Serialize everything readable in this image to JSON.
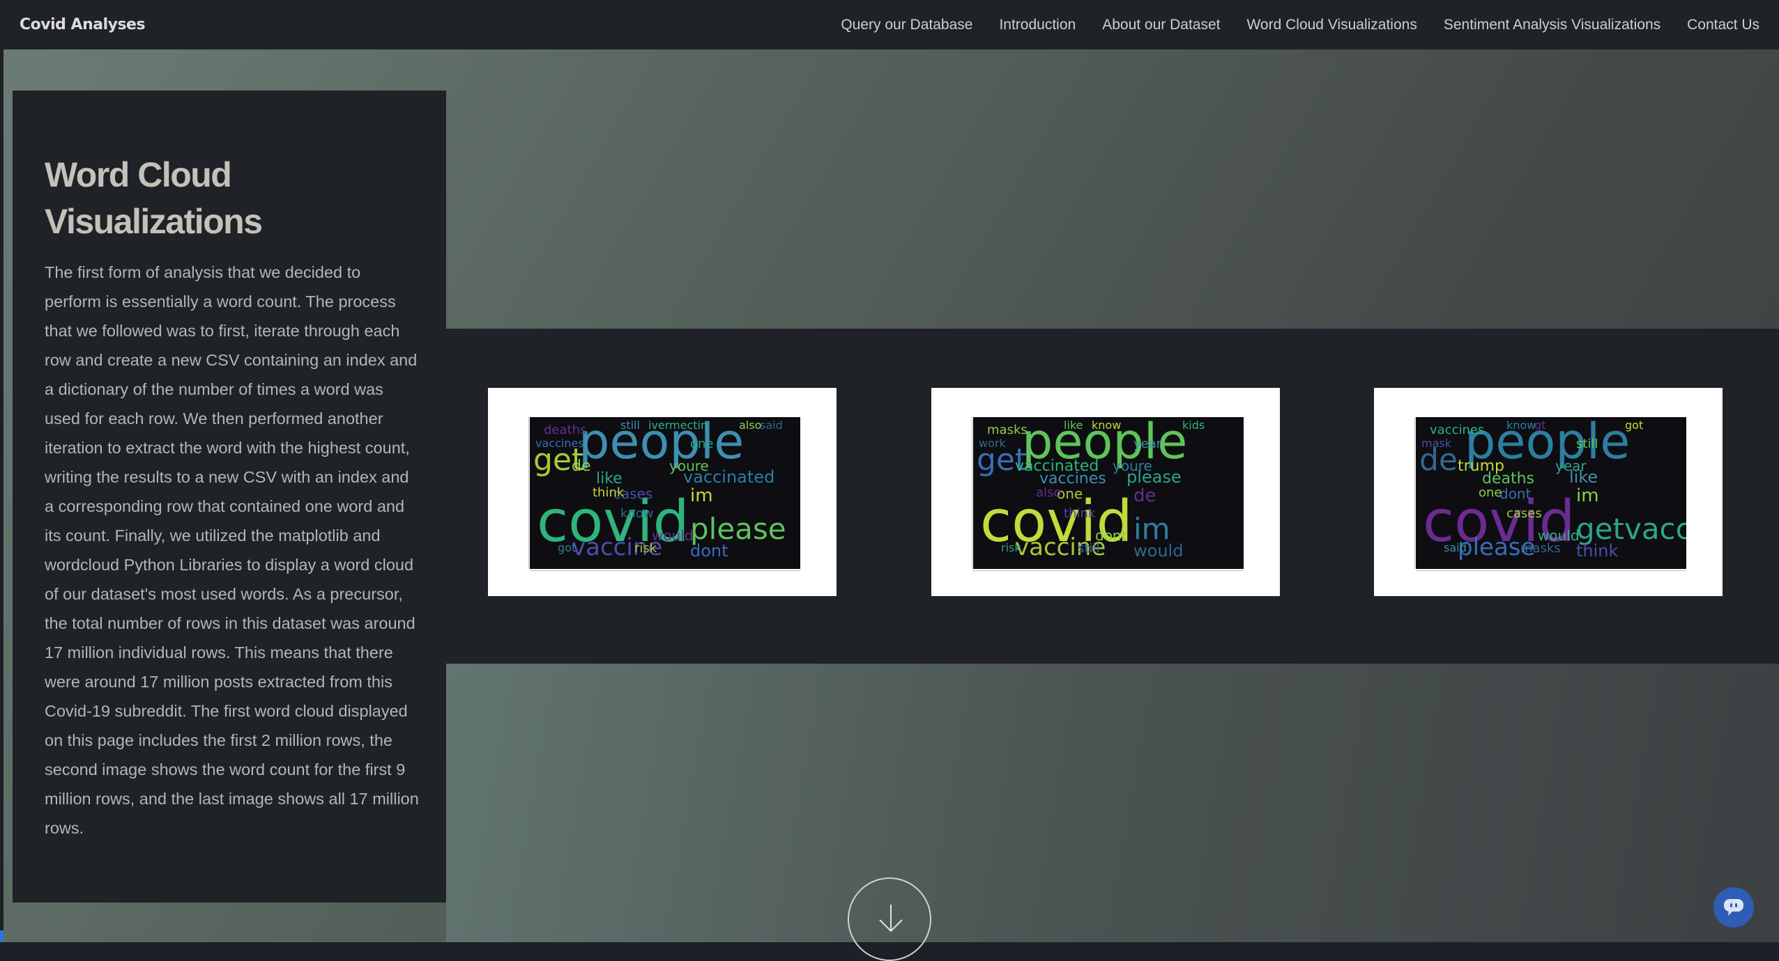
{
  "header": {
    "brand": "Covid Analyses",
    "nav": [
      "Query our Database",
      "Introduction",
      "About our Dataset",
      "Word Cloud Visualizations",
      "Sentiment Analysis Visualizations",
      "Contact Us"
    ]
  },
  "section": {
    "title": "Word Cloud Visualizations",
    "body": "The first form of analysis that we decided to perform is essentially a word count. The process that we followed was to first, iterate through each row and create a new CSV containing an index and a dictionary of the number of times a word was used for each row. We then performed another iteration to extract the word with the highest count, writing the results to a new CSV with an index and a corresponding row that contained one word and its count. Finally, we utilized the matplotlib and wordcloud Python Libraries to display a word cloud of our dataset's most used words. As a precursor, the total number of rows in this dataset was around 17 million individual rows. This means that there were around 17 million posts extracted from this Covid-19 subreddit. The first word cloud displayed on this page includes the first 2 million rows, the second image shows the word count for the first 9 million rows, and the last image shows all 17 million rows."
  },
  "wordclouds": [
    {
      "words": [
        "people",
        "covid",
        "vaccine",
        "please",
        "im",
        "get",
        "vaccinated",
        "would",
        "dont",
        "like",
        "de",
        "know",
        "still",
        "ivermectin",
        "cases",
        "youre",
        "think",
        "risk",
        "got",
        "deaths",
        "vaccines",
        "one",
        "also",
        "said"
      ]
    },
    {
      "words": [
        "people",
        "covid",
        "vaccine",
        "im",
        "de",
        "get",
        "please",
        "dont",
        "would",
        "vaccines",
        "vaccinated",
        "think",
        "like",
        "know",
        "one",
        "youre",
        "also",
        "still",
        "risk",
        "masks",
        "work",
        "year",
        "kids"
      ]
    },
    {
      "words": [
        "people",
        "covid",
        "please",
        "getvaccine",
        "im",
        "de",
        "like",
        "would",
        "think",
        "deaths",
        "trump",
        "cases",
        "know",
        "gt",
        "dont",
        "year",
        "one",
        "masks",
        "said",
        "vaccines",
        "mask",
        "still",
        "got"
      ]
    }
  ],
  "icons": {
    "scroll_down": "arrow-down-icon",
    "chat": "chat-icon"
  },
  "colors": {
    "topbar": "#1f2227",
    "panel": "#1f2227",
    "title": "#c4c1bb",
    "text": "#b5b5b5",
    "chat_button": "#2f5db5"
  }
}
